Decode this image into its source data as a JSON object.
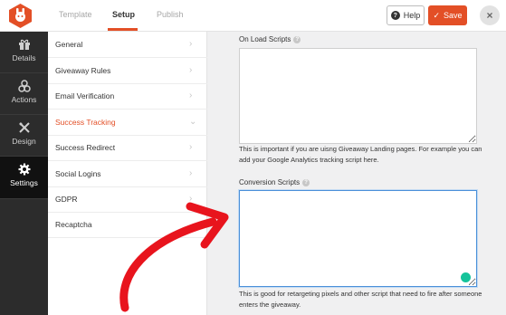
{
  "header": {
    "tabs": [
      {
        "label": "Template",
        "active": false
      },
      {
        "label": "Setup",
        "active": true
      },
      {
        "label": "Publish",
        "active": false
      }
    ],
    "help_label": "Help",
    "save_label": "Save",
    "close_icon": "close-icon",
    "accent_color": "#e34f26"
  },
  "sidenav": {
    "items": [
      {
        "label": "Details",
        "icon": "gift-icon",
        "active": false
      },
      {
        "label": "Actions",
        "icon": "actions-icon",
        "active": false
      },
      {
        "label": "Design",
        "icon": "design-icon",
        "active": false
      },
      {
        "label": "Settings",
        "icon": "gear-icon",
        "active": true
      }
    ]
  },
  "menu": {
    "items": [
      {
        "label": "General",
        "active": false
      },
      {
        "label": "Giveaway Rules",
        "active": false
      },
      {
        "label": "Email Verification",
        "active": false
      },
      {
        "label": "Success Tracking",
        "active": true
      },
      {
        "label": "Success Redirect",
        "active": false
      },
      {
        "label": "Social Logins",
        "active": false
      },
      {
        "label": "GDPR",
        "active": false
      },
      {
        "label": "Recaptcha",
        "active": false
      }
    ]
  },
  "panel": {
    "onload_label": "On Load Scripts",
    "onload_value": "",
    "onload_help": "This is important if you are uisng Giveaway Landing pages. For example you can add your Google Analytics tracking script here.",
    "conversion_label": "Conversion Scripts",
    "conversion_value": "",
    "conversion_help": "This is good for retargeting pixels and other script that need to fire after someone enters the giveaway."
  }
}
